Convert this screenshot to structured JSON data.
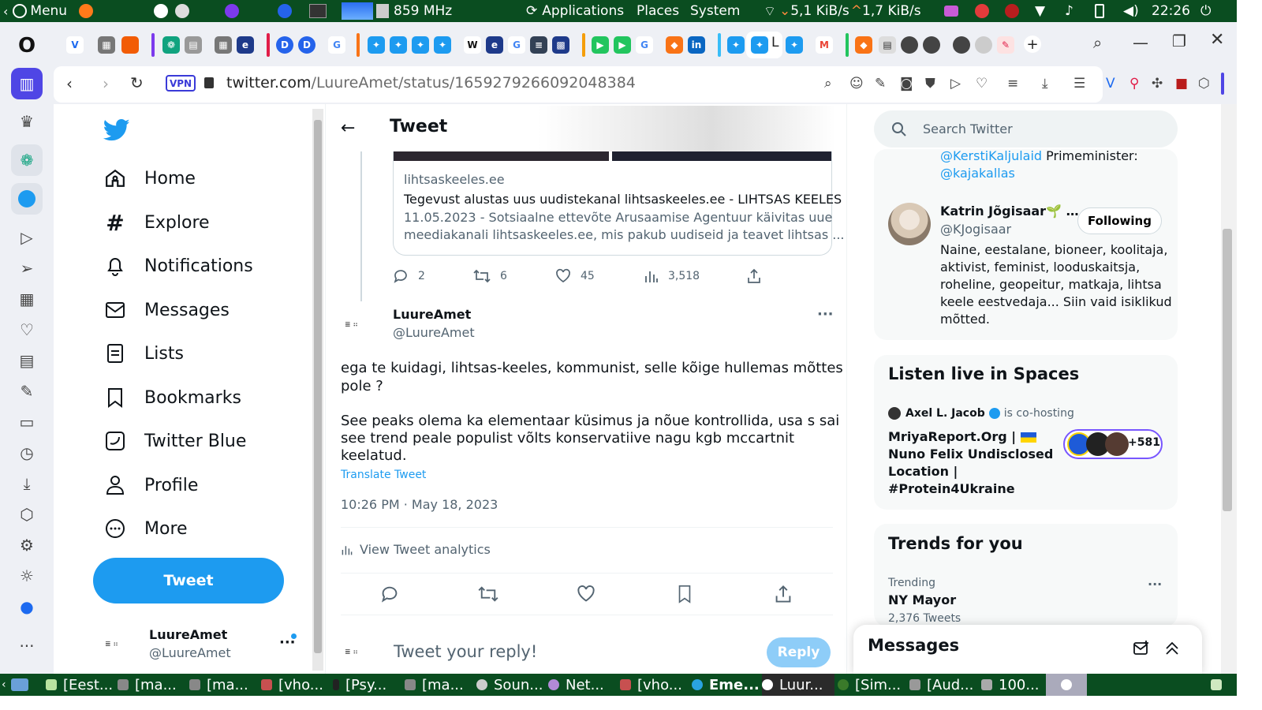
{
  "system_panel": {
    "menu": "Menu",
    "cpu": "859 MHz",
    "applications": "Applications",
    "places": "Places",
    "system": "System",
    "net_down": "5,1 KiB/s",
    "net_up": "1,7 KiB/s",
    "clock": "22:26"
  },
  "browser": {
    "vpn": "VPN",
    "url_host": "twitter.com",
    "url_path": "/LuureAmet/status/1659279266092048384",
    "tab_label": "L"
  },
  "nav": {
    "items": [
      {
        "label": "Home"
      },
      {
        "label": "Explore"
      },
      {
        "label": "Notifications"
      },
      {
        "label": "Messages"
      },
      {
        "label": "Lists"
      },
      {
        "label": "Bookmarks"
      },
      {
        "label": "Twitter Blue"
      },
      {
        "label": "Profile"
      },
      {
        "label": "More"
      }
    ],
    "tweet_button": "Tweet",
    "account_name": "LuureAmet",
    "account_handle": "@LuureAmet"
  },
  "header": {
    "title": "Tweet"
  },
  "quoted_card": {
    "domain": "lihtsaskeeles.ee",
    "title": "Tegevust alustas uus uudistekanal lihtsaskeeles.ee - LIHTSAS KEELES",
    "desc1": "11.05.2023 - Sotsiaalne ettevõte Arusaamise Agentuur käivitas uue",
    "desc2": "meediakanali lihtsaskeeles.ee, mis pakub uudiseid ja teavet lihtsas ..."
  },
  "parent_actions": {
    "replies": "2",
    "retweets": "6",
    "likes": "45",
    "views": "3,518"
  },
  "tweet": {
    "name": "LuureAmet",
    "handle": "@LuureAmet",
    "line1": "ega te kuidagi, lihtsas-keeles, kommunist, selle kõige hullemas mõttes",
    "line2": "pole ?",
    "line3": "See peaks olema ka elementaar küsimus ja nõue kontrollida, usa s sai",
    "line4": "see trend peale populist võlts konservatiive nagu kgb mccartnit",
    "line5": "keelatud.",
    "translate": "Translate Tweet",
    "timestamp": "10:26 PM · May 18, 2023",
    "analytics": "View Tweet analytics"
  },
  "reply": {
    "placeholder": "Tweet your reply!",
    "button": "Reply"
  },
  "sidebar": {
    "search_placeholder": "Search Twitter",
    "prev_line1_link": "@KerstiKaljulaid",
    "prev_line1_text": " Primeminister:",
    "prev_line2_link": "@kajakallas",
    "user_name": "Katrin Jõgisaar",
    "user_handle": "@KJogisaar",
    "follow_button": "Following",
    "bio1": "Naine, eestalane, bioneer, koolitaja,",
    "bio2": "aktivist, feminist, looduskaitsja,",
    "bio3": "roheline, geopeitur, matkaja, lihtsa",
    "bio4": "keele eestvedaja... Siin vaid isiklikud",
    "bio5": "mõtted.",
    "spaces_title": "Listen live in Spaces",
    "space_host": "Axel L. Jacob",
    "space_cohost": "is co-hosting",
    "space_t1": "MriyaReport.Org |",
    "space_t2": "Nuno Felix Undisclosed",
    "space_t3": "Location |",
    "space_t4": "#Protein4Ukraine",
    "space_count": "+581",
    "trends_title": "Trends for you",
    "trend_label": "Trending",
    "trend_name": "NY Mayor",
    "trend_count": "2,376 Tweets",
    "messages_title": "Messages"
  },
  "taskbar": {
    "items": [
      {
        "label": "[Eest..."
      },
      {
        "label": "[ma..."
      },
      {
        "label": "[ma..."
      },
      {
        "label": "[vho..."
      },
      {
        "label": "[Psy..."
      },
      {
        "label": "[ma..."
      },
      {
        "label": "Soun..."
      },
      {
        "label": "Net..."
      },
      {
        "label": "[vho..."
      },
      {
        "label": "Eme..."
      },
      {
        "label": "Luur..."
      },
      {
        "label": "[Sim..."
      },
      {
        "label": "[Aud..."
      },
      {
        "label": "100..."
      }
    ]
  },
  "colors": {
    "twitter_blue": "#1d9bf0",
    "panel_green": "#0a4d20"
  }
}
